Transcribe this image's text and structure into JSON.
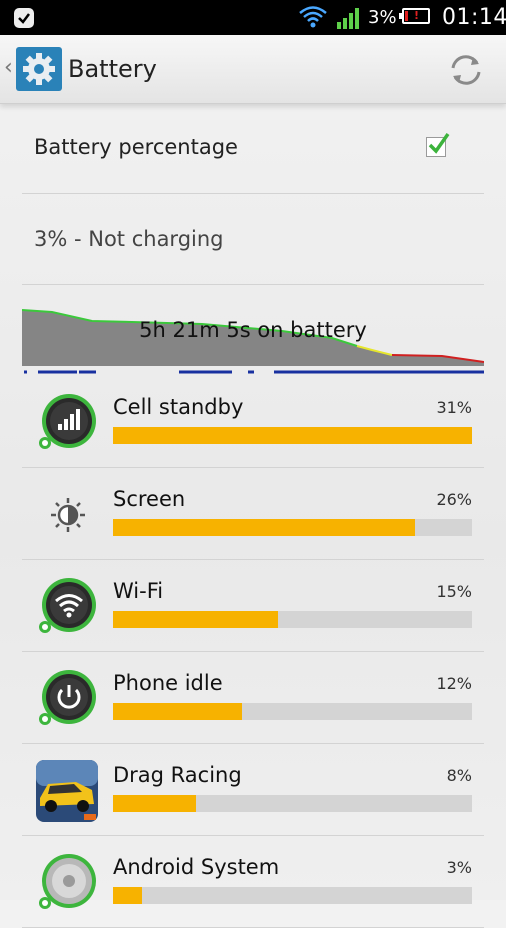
{
  "status_bar": {
    "battery_pct": "3%",
    "time": "01:14"
  },
  "action_bar": {
    "title": "Battery"
  },
  "settings": {
    "battery_percentage_label": "Battery percentage",
    "battery_percentage_checked": true,
    "status_text": "3% - Not charging"
  },
  "graph": {
    "label": "5h 21m 5s on battery"
  },
  "usage": [
    {
      "name": "Cell standby",
      "percent": "31%",
      "fraction": 1.0,
      "icon": "cell-signal-icon"
    },
    {
      "name": "Screen",
      "percent": "26%",
      "fraction": 0.84,
      "icon": "brightness-icon"
    },
    {
      "name": "Wi-Fi",
      "percent": "15%",
      "fraction": 0.46,
      "icon": "wifi-icon"
    },
    {
      "name": "Phone idle",
      "percent": "12%",
      "fraction": 0.36,
      "icon": "power-icon"
    },
    {
      "name": "Drag Racing",
      "percent": "8%",
      "fraction": 0.23,
      "icon": "drag-racing-app-icon"
    },
    {
      "name": "Android System",
      "percent": "3%",
      "fraction": 0.08,
      "icon": "android-system-icon"
    }
  ],
  "colors": {
    "accent_bar": "#f7b200",
    "bar_track": "#d4d4d4",
    "graph_good": "#3cc83c",
    "graph_mid": "#e6e62c",
    "graph_low": "#d02020",
    "graph_signal": "#1830a0"
  }
}
